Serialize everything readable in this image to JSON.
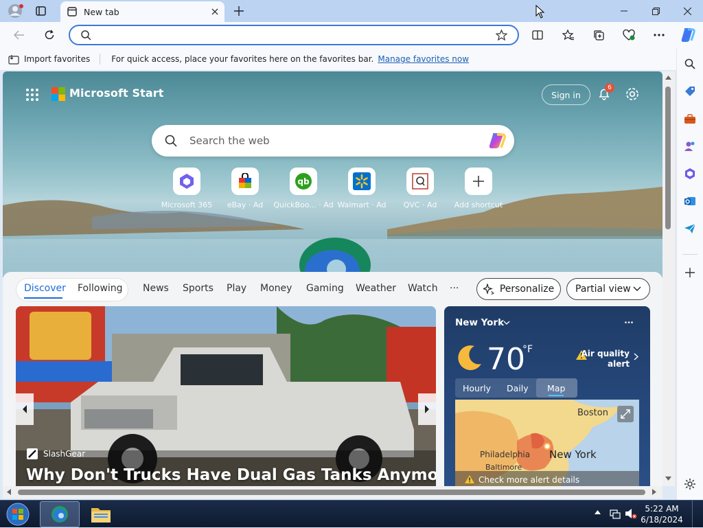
{
  "browser": {
    "tab_title": "New tab",
    "address_value": "",
    "accent": "#3b78d8"
  },
  "favorites_bar": {
    "import_label": "Import favorites",
    "message": "For quick access, place your favorites here on the favorites bar.",
    "manage_link": "Manage favorites now"
  },
  "start": {
    "brand": "Microsoft Start",
    "sign_in": "Sign in",
    "notification_count": "6",
    "search_placeholder": "Search the web",
    "shortcuts": [
      {
        "label": "Microsoft 365",
        "icon": "m365-icon"
      },
      {
        "label": "eBay · Ad",
        "icon": "ebay-icon"
      },
      {
        "label": "QuickBoo... · Ad",
        "icon": "quickbooks-icon"
      },
      {
        "label": "Walmart · Ad",
        "icon": "walmart-icon"
      },
      {
        "label": "QVC · Ad",
        "icon": "qvc-icon"
      },
      {
        "label": "Add shortcut",
        "icon": "plus-icon"
      }
    ]
  },
  "feed": {
    "tabs": [
      "Discover",
      "Following",
      "News",
      "Sports",
      "Play",
      "Money",
      "Gaming",
      "Weather",
      "Watch"
    ],
    "more": "···",
    "personalize": "Personalize",
    "view": "Partial view",
    "article": {
      "source": "SlashGear",
      "title": "Why Don't Trucks Have Dual Gas Tanks Anymore?"
    }
  },
  "weather": {
    "city": "New York",
    "temperature": "70",
    "unit": "°F",
    "alert_line1": "Air quality",
    "alert_line2": "alert",
    "tabs": [
      "Hourly",
      "Daily",
      "Map"
    ],
    "active_tab": "Map",
    "map_labels": [
      "Boston",
      "Philadelphia",
      "New York",
      "Baltimore"
    ],
    "alert_details": "Check more alert details"
  },
  "taskbar": {
    "time": "5:22 AM",
    "date": "6/18/2024"
  }
}
